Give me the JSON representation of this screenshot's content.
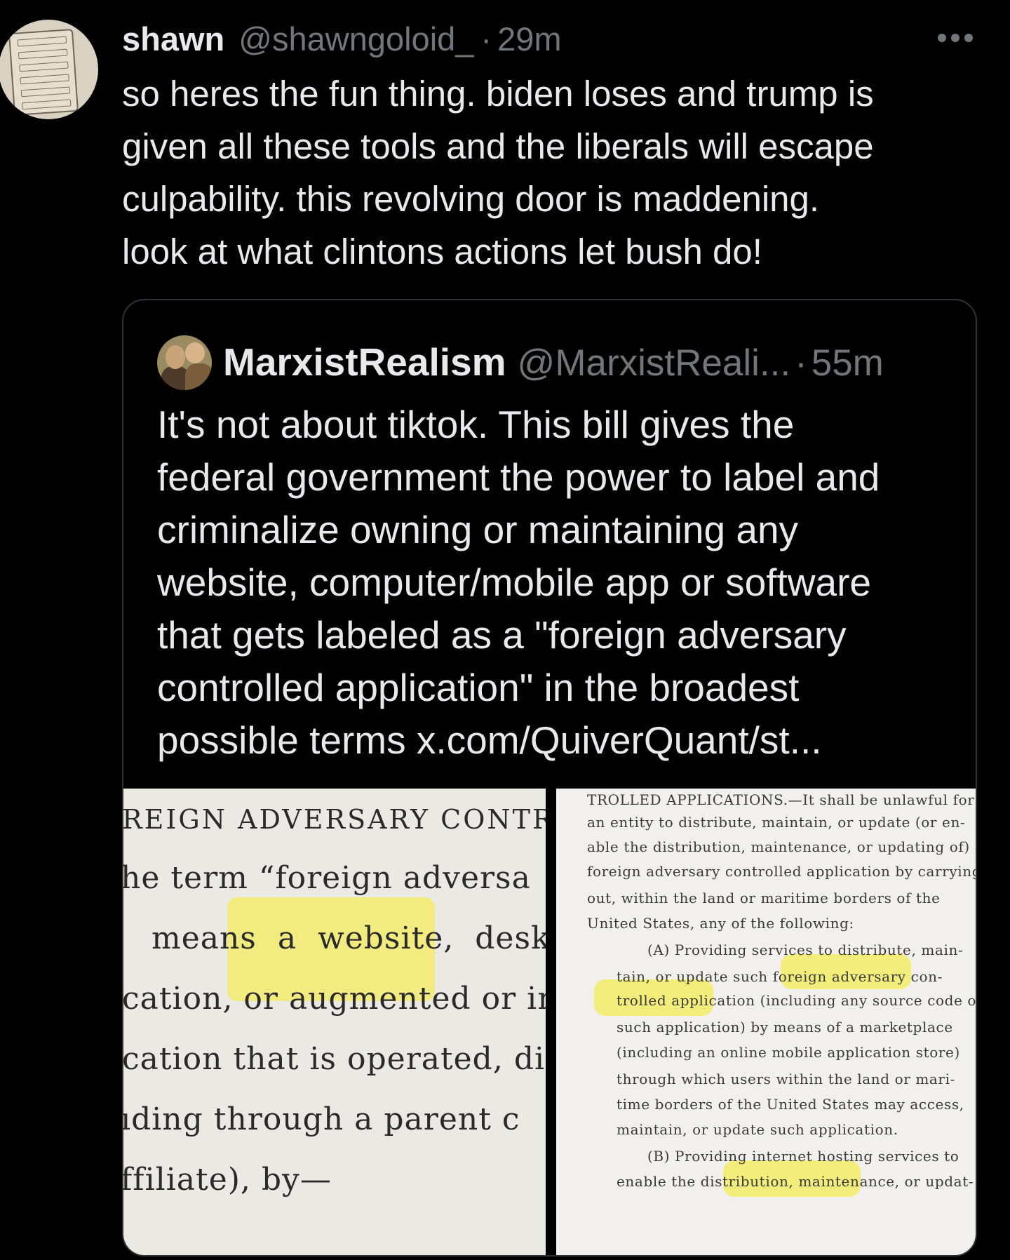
{
  "tweet": {
    "name": "shawn",
    "handle": "@shawngoloid_",
    "separator": "·",
    "time": "29m",
    "more_icon": "more-horizontal-icon",
    "lines": [
      "so heres the fun thing. biden loses and trump is",
      "given all these tools and the liberals will escape",
      "culpability. this revolving door is maddening.",
      "look at what clintons actions let bush do!"
    ]
  },
  "quote": {
    "name": "MarxistRealism",
    "handle": "@MarxistReali...",
    "separator": "·",
    "time": "55m",
    "lines": [
      "It's not about tiktok. This bill gives the",
      "federal government the power to label and",
      "criminalize owning or maintaining any",
      "website, computer/mobile app or software",
      "that gets labeled as a \"foreign adversary",
      "controlled application\" in the broadest"
    ],
    "last_line_prefix": "possible terms ",
    "link_text": "x.com/QuiverQuant/st..."
  },
  "media": {
    "left_image": {
      "lines": [
        "REIGN ADVERSARY CONTRC",
        "he  term  “foreign  adversa",
        "  means  a  website,  deskto",
        "cation,  or  augmented  or  in",
        "cation  that  is  operated,  di",
        "ıding  through  a  parent  c",
        "ffiliate),  by—"
      ]
    },
    "right_image": {
      "lines": [
        "TROLLED APPLICATIONS.—It shall be unlawful for",
        "an entity to distribute, maintain, or update (or en-",
        "able the distribution, maintenance, or updating of) a",
        "foreign adversary controlled application by carrying",
        "out, within the land or maritime borders of the",
        "United States, any of the following:",
        "(A) Providing services to distribute, main-",
        "tain, or update such foreign adversary con-",
        "trolled application (including any source code of",
        "such application) by means of a marketplace",
        "(including an online mobile application store)",
        "through which users within the land or mari-",
        "time borders of the United States may access,",
        "maintain, or update such application.",
        "(B) Providing internet hosting services to",
        "enable the distribution, maintenance, or updat-"
      ]
    }
  },
  "colors": {
    "background": "#000000",
    "text_primary": "#e7e9ea",
    "text_secondary": "#71767b",
    "border": "#2f3336",
    "highlight": "#f3ec6f"
  }
}
